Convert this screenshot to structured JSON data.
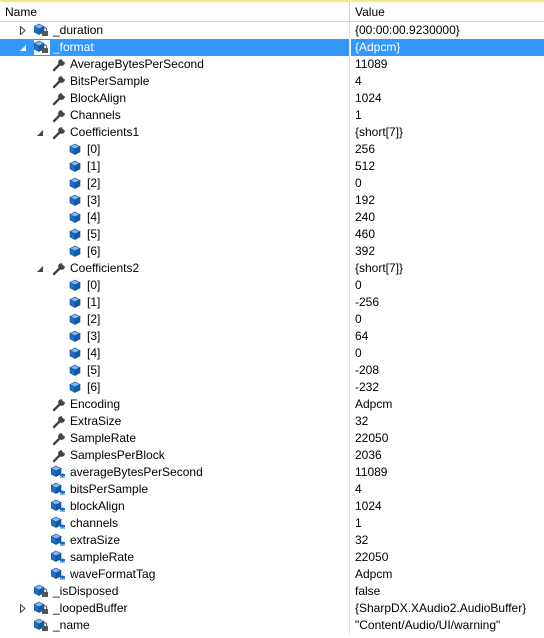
{
  "header": {
    "name_label": "Name",
    "value_label": "Value"
  },
  "rows": [
    {
      "level": 0,
      "expander": "collapsed",
      "icon": "private-field-icon",
      "name": "_duration",
      "value": "{00:00:00.9230000}"
    },
    {
      "level": 0,
      "expander": "expanded",
      "icon": "private-field-icon",
      "name": "_format",
      "value": "{Adpcm}",
      "selected": true
    },
    {
      "level": 1,
      "expander": "none",
      "icon": "property-wrench-icon",
      "name": "AverageBytesPerSecond",
      "value": "11089"
    },
    {
      "level": 1,
      "expander": "none",
      "icon": "property-wrench-icon",
      "name": "BitsPerSample",
      "value": "4"
    },
    {
      "level": 1,
      "expander": "none",
      "icon": "property-wrench-icon",
      "name": "BlockAlign",
      "value": "1024"
    },
    {
      "level": 1,
      "expander": "none",
      "icon": "property-wrench-icon",
      "name": "Channels",
      "value": "1"
    },
    {
      "level": 1,
      "expander": "expanded",
      "icon": "property-wrench-icon",
      "name": "Coefficients1",
      "value": "{short[7]}"
    },
    {
      "level": 2,
      "expander": "none",
      "icon": "array-element-icon",
      "name": "[0]",
      "value": "256"
    },
    {
      "level": 2,
      "expander": "none",
      "icon": "array-element-icon",
      "name": "[1]",
      "value": "512"
    },
    {
      "level": 2,
      "expander": "none",
      "icon": "array-element-icon",
      "name": "[2]",
      "value": "0"
    },
    {
      "level": 2,
      "expander": "none",
      "icon": "array-element-icon",
      "name": "[3]",
      "value": "192"
    },
    {
      "level": 2,
      "expander": "none",
      "icon": "array-element-icon",
      "name": "[4]",
      "value": "240"
    },
    {
      "level": 2,
      "expander": "none",
      "icon": "array-element-icon",
      "name": "[5]",
      "value": "460"
    },
    {
      "level": 2,
      "expander": "none",
      "icon": "array-element-icon",
      "name": "[6]",
      "value": "392"
    },
    {
      "level": 1,
      "expander": "expanded",
      "icon": "property-wrench-icon",
      "name": "Coefficients2",
      "value": "{short[7]}"
    },
    {
      "level": 2,
      "expander": "none",
      "icon": "array-element-icon",
      "name": "[0]",
      "value": "0"
    },
    {
      "level": 2,
      "expander": "none",
      "icon": "array-element-icon",
      "name": "[1]",
      "value": "-256"
    },
    {
      "level": 2,
      "expander": "none",
      "icon": "array-element-icon",
      "name": "[2]",
      "value": "0"
    },
    {
      "level": 2,
      "expander": "none",
      "icon": "array-element-icon",
      "name": "[3]",
      "value": "64"
    },
    {
      "level": 2,
      "expander": "none",
      "icon": "array-element-icon",
      "name": "[4]",
      "value": "0"
    },
    {
      "level": 2,
      "expander": "none",
      "icon": "array-element-icon",
      "name": "[5]",
      "value": "-208"
    },
    {
      "level": 2,
      "expander": "none",
      "icon": "array-element-icon",
      "name": "[6]",
      "value": "-232"
    },
    {
      "level": 1,
      "expander": "none",
      "icon": "property-wrench-icon",
      "name": "Encoding",
      "value": "Adpcm"
    },
    {
      "level": 1,
      "expander": "none",
      "icon": "property-wrench-icon",
      "name": "ExtraSize",
      "value": "32"
    },
    {
      "level": 1,
      "expander": "none",
      "icon": "property-wrench-icon",
      "name": "SampleRate",
      "value": "22050"
    },
    {
      "level": 1,
      "expander": "none",
      "icon": "property-wrench-icon",
      "name": "SamplesPerBlock",
      "value": "2036"
    },
    {
      "level": 1,
      "expander": "none",
      "icon": "internal-field-icon",
      "name": "averageBytesPerSecond",
      "value": "11089"
    },
    {
      "level": 1,
      "expander": "none",
      "icon": "internal-field-icon",
      "name": "bitsPerSample",
      "value": "4"
    },
    {
      "level": 1,
      "expander": "none",
      "icon": "internal-field-icon",
      "name": "blockAlign",
      "value": "1024"
    },
    {
      "level": 1,
      "expander": "none",
      "icon": "internal-field-icon",
      "name": "channels",
      "value": "1"
    },
    {
      "level": 1,
      "expander": "none",
      "icon": "internal-field-icon",
      "name": "extraSize",
      "value": "32"
    },
    {
      "level": 1,
      "expander": "none",
      "icon": "internal-field-icon",
      "name": "sampleRate",
      "value": "22050"
    },
    {
      "level": 1,
      "expander": "none",
      "icon": "internal-field-icon",
      "name": "waveFormatTag",
      "value": "Adpcm"
    },
    {
      "level": 0,
      "expander": "none",
      "icon": "private-field-icon",
      "name": "_isDisposed",
      "value": "false"
    },
    {
      "level": 0,
      "expander": "collapsed",
      "icon": "private-field-icon",
      "name": "_loopedBuffer",
      "value": "{SharpDX.XAudio2.AudioBuffer}"
    },
    {
      "level": 0,
      "expander": "none",
      "icon": "private-field-icon",
      "name": "_name",
      "value": "\"Content/Audio/UI/warning\""
    }
  ],
  "colors": {
    "selection": "#3399ff",
    "cube_blue": "#1e6fc8",
    "header_accent": "#f4e98a"
  }
}
